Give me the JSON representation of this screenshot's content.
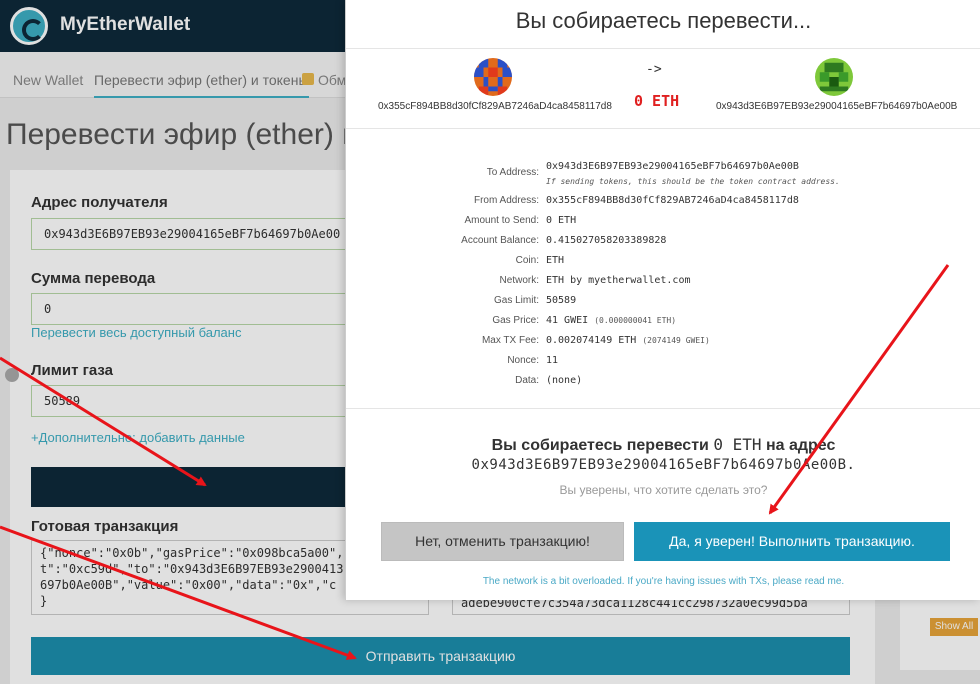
{
  "app": {
    "brand": "MyEtherWallet"
  },
  "nav": {
    "new_wallet": "New Wallet",
    "send": "Перевести эфир (ether) и токены",
    "swap": "Обм"
  },
  "page": {
    "title": "Перевести эфир (ether) и"
  },
  "form": {
    "recipient_label": "Адрес получателя",
    "recipient_value": "0x943d3E6B97EB93e29004165eBF7b64697b0Ae00",
    "amount_label": "Сумма перевода",
    "amount_value": "0",
    "send_all_link": "Перевести весь доступный баланс",
    "gas_label": "Лимит газа",
    "gas_value": "50589",
    "advanced_link": "+Дополнительно: добавить данные",
    "raw_tx_label": "Готовая транзакция",
    "raw_tx_lines": [
      "{\"nonce\":\"0x0b\",\"gasPrice\":\"0x098bca5a00\",",
      "t\":\"0xc59d\",\"to\":\"0x943d3E6B97EB93e2900413",
      "697b0Ae00B\",\"value\":\"0x00\",\"data\":\"0x\",\"c",
      "}"
    ],
    "signed_tx_tail": "adebe900cfe7c354a73dca1128c441cc298732a0ec99d5ba",
    "send_button": "Отправить транзакцию"
  },
  "side": {
    "show_all": "Show All"
  },
  "modal": {
    "title": "Вы собираетесь перевести...",
    "from_address": "0x355cF894BB8d30fCf829AB7246aD4ca8458117d8",
    "arrow": "->",
    "amount": "0 ETH",
    "to_address": "0x943d3E6B97EB93e29004165eBF7b64697b0Ae00B",
    "details": [
      {
        "key": "To Address:",
        "value": "0x943d3E6B97EB93e29004165eBF7b64697b0Ae00B",
        "sub": ""
      },
      {
        "key": "From Address:",
        "value": "0x355cF894BB8d30fCf829AB7246aD4ca8458117d8",
        "sub": ""
      },
      {
        "key": "Amount to Send:",
        "value": "0 ETH",
        "sub": ""
      },
      {
        "key": "Account Balance:",
        "value": "0.415027058203389828",
        "sub": ""
      },
      {
        "key": "Coin:",
        "value": "ETH",
        "sub": ""
      },
      {
        "key": "Network:",
        "value": "ETH by myetherwallet.com",
        "sub": ""
      },
      {
        "key": "Gas Limit:",
        "value": "50589",
        "sub": ""
      },
      {
        "key": "Gas Price:",
        "value": "41 GWEI",
        "sub": "(0.000000041 ETH)"
      },
      {
        "key": "Max TX Fee:",
        "value": "0.002074149 ETH",
        "sub": "(2074149 GWEI)"
      },
      {
        "key": "Nonce:",
        "value": "11",
        "sub": ""
      },
      {
        "key": "Data:",
        "value": "(none)",
        "sub": ""
      }
    ],
    "token_note": "If sending tokens, this should be the token contract address.",
    "confirm_prefix": "Вы собираетесь перевести",
    "confirm_amount": "0 ETH",
    "confirm_suffix": "на адрес",
    "confirm_address": "0x943d3E6B97EB93e29004165eBF7b64697b0Ae00B.",
    "sure": "Вы уверены, что хотите сделать это?",
    "cancel_button": "Нет, отменить транзакцию!",
    "confirm_button": "Да, я уверен! Выполнить транзакцию.",
    "footnote": "The network is a bit overloaded. If you're having issues with TXs, please read me."
  },
  "colors": {
    "accent": "#1a93b8",
    "header": "#0e2a3b",
    "arrow": "#e8141a",
    "amount": "#e02020"
  }
}
